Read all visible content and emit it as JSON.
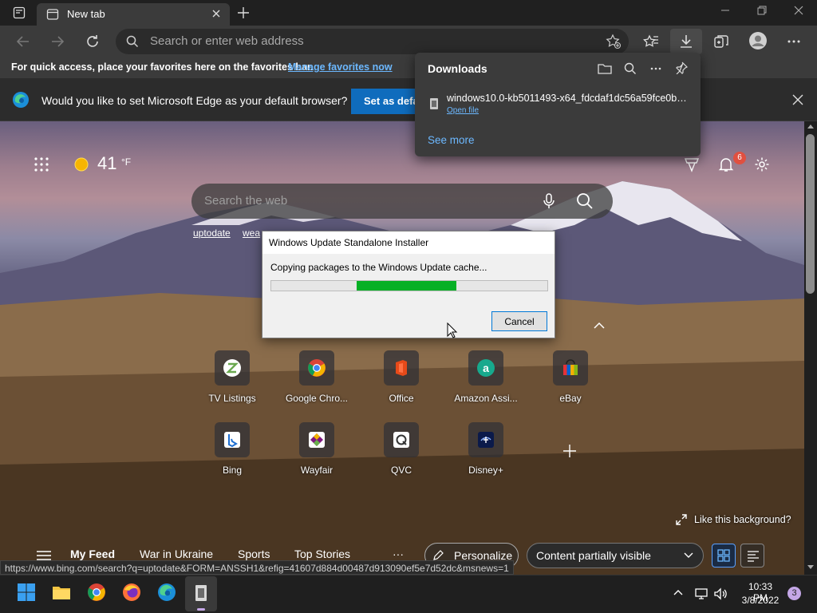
{
  "browser": {
    "tab_title": "New tab",
    "address_placeholder": "Search or enter web address"
  },
  "favorites_bar": {
    "text": "For quick access, place your favorites here on the favorites bar.",
    "link": "Manage favorites now"
  },
  "default_prompt": {
    "message": "Would you like to set Microsoft Edge as your default browser?",
    "button": "Set as default"
  },
  "downloads": {
    "title": "Downloads",
    "filename": "windows10.0-kb5011493-x64_fdcdaf1dc56a59fce0b786...",
    "open_file": "Open file",
    "see_more": "See more"
  },
  "newtab": {
    "temperature": "41",
    "unit": "°F",
    "search_placeholder": "Search the web",
    "trending": [
      "uptodate",
      "wea"
    ],
    "notification_count": "6",
    "quick_links": [
      {
        "label": "TV Listings",
        "icon": "z-icon"
      },
      {
        "label": "Google Chro...",
        "icon": "chrome-icon"
      },
      {
        "label": "Office",
        "icon": "office-icon"
      },
      {
        "label": "Amazon Assi...",
        "icon": "amazon-icon"
      },
      {
        "label": "eBay",
        "icon": "ebay-icon"
      },
      {
        "label": "Bing",
        "icon": "bing-icon"
      },
      {
        "label": "Wayfair",
        "icon": "wayfair-icon"
      },
      {
        "label": "QVC",
        "icon": "qvc-icon"
      },
      {
        "label": "Disney+",
        "icon": "disney-icon"
      }
    ],
    "like_background": "Like this background?",
    "feed": {
      "my_feed": "My Feed",
      "items": [
        "War in Ukraine",
        "Sports",
        "Top Stories"
      ],
      "more": "···",
      "personalize": "Personalize",
      "content_visibility": "Content partially visible"
    }
  },
  "status_url": "https://www.bing.com/search?q=uptodate&FORM=ANSSH1&refig=41607d884d00487d913090ef5e7d52dc&msnews=1",
  "dialog": {
    "title": "Windows Update Standalone Installer",
    "message": "Copying packages to the Windows Update cache...",
    "progress_start": 0.31,
    "progress_end": 0.67,
    "cancel": "Cancel"
  },
  "taskbar": {
    "time": "10:33 PM",
    "date": "3/8/2022",
    "notification_count": "3"
  },
  "colors": {
    "accent": "#0f6cbd",
    "link": "#6cb8ff",
    "progress": "#06b025"
  }
}
